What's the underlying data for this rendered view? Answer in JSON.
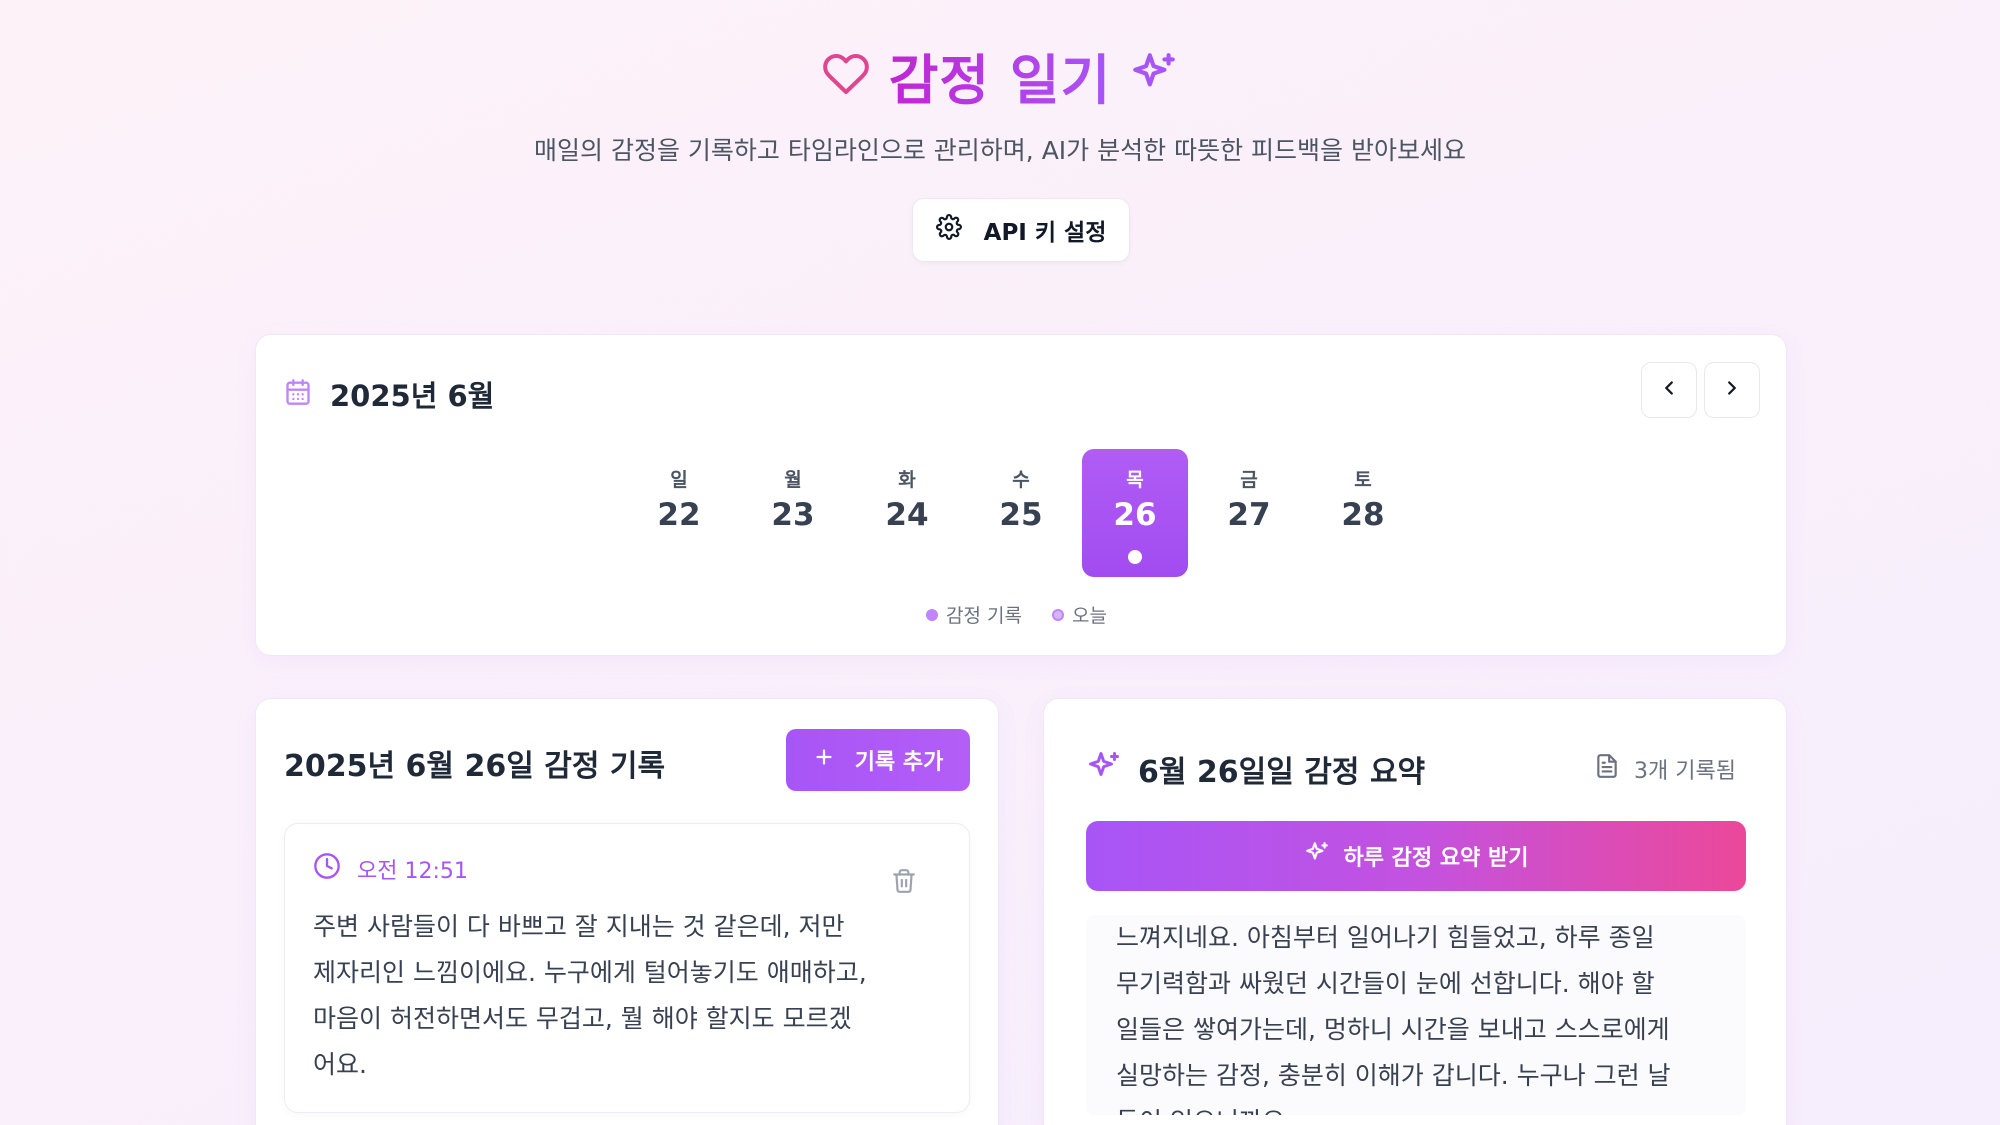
{
  "header": {
    "title": "감정 일기",
    "subtitle": "매일의 감정을 기록하고 타임라인으로 관리하며, AI가 분석한 따뜻한 피드백을 받아보세요",
    "api_button": "API 키 설정"
  },
  "calendar": {
    "month_label": "2025년 6월",
    "days": [
      {
        "weekday": "일",
        "date": "22"
      },
      {
        "weekday": "월",
        "date": "23"
      },
      {
        "weekday": "화",
        "date": "24"
      },
      {
        "weekday": "수",
        "date": "25"
      },
      {
        "weekday": "목",
        "date": "26",
        "selected": true,
        "has_entry": true
      },
      {
        "weekday": "금",
        "date": "27"
      },
      {
        "weekday": "토",
        "date": "28"
      }
    ],
    "legend": {
      "entry": "감정 기록",
      "today": "오늘"
    }
  },
  "records": {
    "title": "2025년 6월 26일 감정 기록",
    "add_button": "기록 추가",
    "entry": {
      "time": "오전 12:51",
      "text": "주변 사람들이 다 바쁘고 잘 지내는 것 같은데, 저만 제자리인 느낌이에요. 누구에게 털어놓기도 애매하고, 마음이 허전하면서도 무겁고, 뭘 해야 할지도 모르겠어요."
    }
  },
  "summary": {
    "title": "6월 26일일 감정 요약",
    "count": "3개 기록됨",
    "button": "하루 감정 요약 받기",
    "text": "느껴지네요.  아침부터 일어나기 힘들었고, 하루 종일\n무기력함과 싸웠던 시간들이 눈에 선합니다.  해야 할\n일들은 쌓여가는데, 멍하니 시간을 보내고 스스로에게\n실망하는 감정, 충분히 이해가 갑니다.  누구나 그런 날\n들이 있으니까요."
  },
  "colors": {
    "accent": "#a855f7",
    "pink": "#ec4899",
    "legend_entry": "#c084fc",
    "legend_today": "#c084fc"
  }
}
